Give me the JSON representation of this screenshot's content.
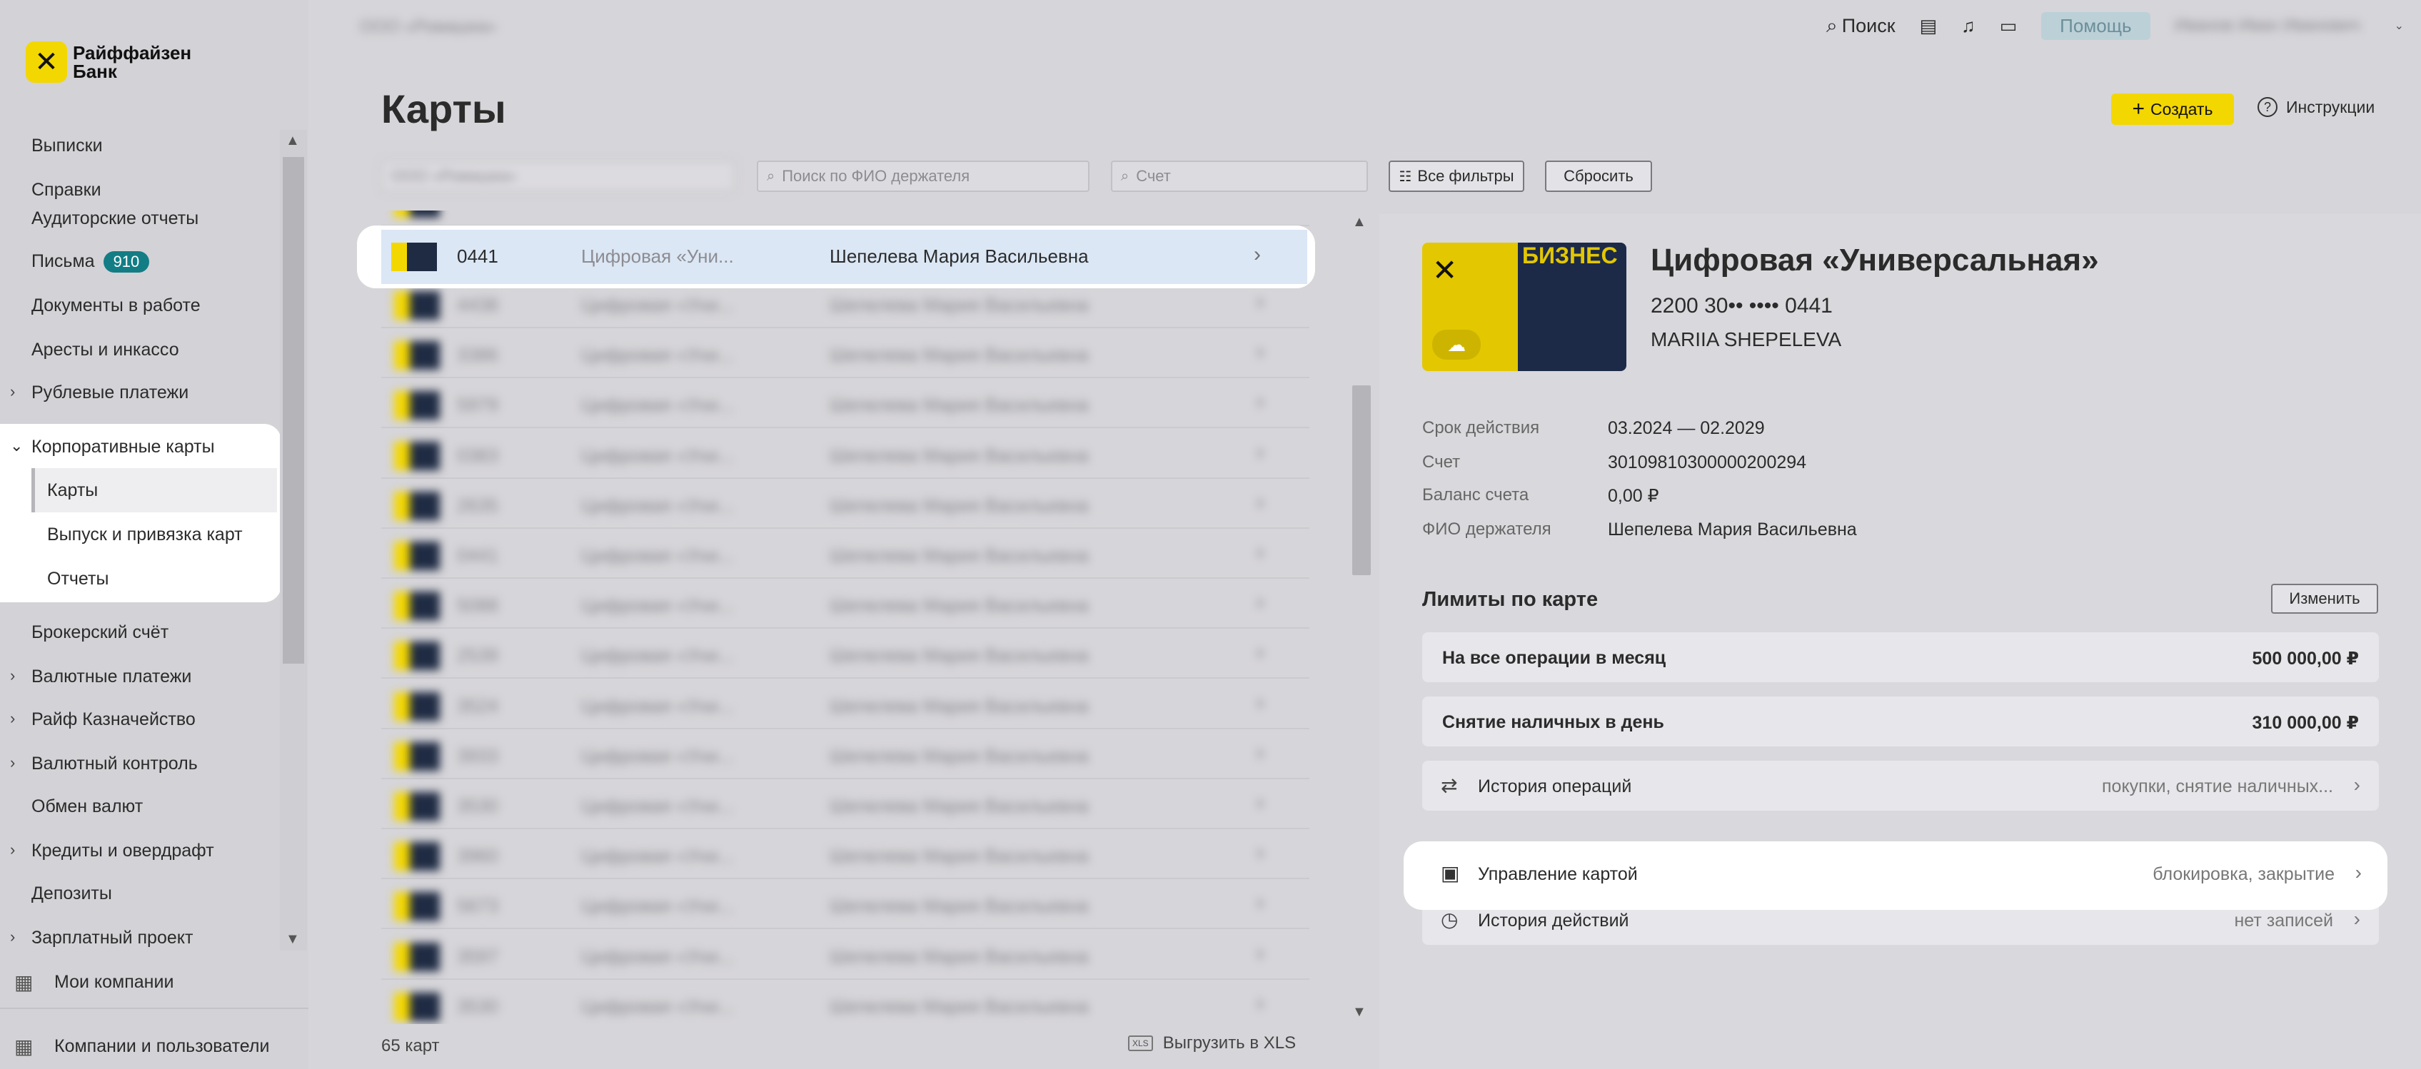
{
  "sidebar": {
    "logo_text": "Райффайзен Банк",
    "items": [
      {
        "label": "Выписки"
      },
      {
        "label": "Справки"
      },
      {
        "label": "Аудиторские отчеты"
      },
      {
        "label": "Письма",
        "badge": "910"
      },
      {
        "label": "Документы в работе"
      },
      {
        "label": "Аресты и инкассо"
      },
      {
        "label": "Рублевые платежи"
      },
      {
        "label": "Корпоративные карты"
      },
      {
        "label": "Брокерский счёт"
      },
      {
        "label": "Валютные платежи"
      },
      {
        "label": "Райф Казначейство"
      },
      {
        "label": "Валютный контроль"
      },
      {
        "label": "Обмен валют"
      },
      {
        "label": "Кредиты и овердрафт"
      },
      {
        "label": "Депозиты"
      },
      {
        "label": "Зарплатный проект"
      }
    ],
    "corp_cards_sub": [
      {
        "label": "Карты"
      },
      {
        "label": "Выпуск и привязка карт"
      },
      {
        "label": "Отчеты"
      }
    ],
    "footer": {
      "my_companies": "Мои компании",
      "companies_users": "Компании и пользователи"
    }
  },
  "header": {
    "org_name": "ООО «Ромашка»",
    "search_label": "Поиск",
    "help_label": "Помощь",
    "user_name": "Иванов Иван Иванович"
  },
  "page": {
    "title": "Карты",
    "create_label": "Создать",
    "instructions_label": "Инструкции"
  },
  "filters": {
    "account_select": "ООО «Ромашка»",
    "holder_search_placeholder": "Поиск по ФИО держателя",
    "account_placeholder": "Счет",
    "all_filters_label": "Все фильтры",
    "reset_label": "Сбросить"
  },
  "list": {
    "selected": {
      "last4": "0441",
      "product": "Цифровая «Уни...",
      "holder": "Шепелева Мария Васильевна"
    },
    "rows": [
      {
        "last4": "4438",
        "product": "Цифровая «Уни...",
        "holder": "Шепелева Мария Васильевна"
      },
      {
        "last4": "3386",
        "product": "Цифровая «Уни...",
        "holder": "Шепелева Мария Васильевна"
      },
      {
        "last4": "5979",
        "product": "Цифровая «Уни...",
        "holder": "Шепелева Мария Васильевна"
      },
      {
        "last4": "0383",
        "product": "Цифровая «Уни...",
        "holder": "Шепелева Мария Васильевна"
      },
      {
        "last4": "2635",
        "product": "Цифровая «Уни...",
        "holder": "Шепелева Мария Васильевна"
      },
      {
        "last4": "0441",
        "product": "Цифровая «Уни...",
        "holder": "Шепелева Мария Васильевна"
      },
      {
        "last4": "5088",
        "product": "Цифровая «Уни...",
        "holder": "Шепелева Мария Васильевна"
      },
      {
        "last4": "2539",
        "product": "Цифровая «Уни...",
        "holder": "Шепелева Мария Васильевна"
      },
      {
        "last4": "3524",
        "product": "Цифровая «Уни...",
        "holder": "Шепелева Мария Васильевна"
      },
      {
        "last4": "3933",
        "product": "Цифровая «Уни...",
        "holder": "Шепелева Мария Васильевна"
      },
      {
        "last4": "3530",
        "product": "Цифровая «Уни...",
        "holder": "Шепелева Мария Васильевна"
      },
      {
        "last4": "3960",
        "product": "Цифровая «Уни...",
        "holder": "Шепелева Мария Васильевна"
      },
      {
        "last4": "5673",
        "product": "Цифровая «Уни...",
        "holder": "Шепелева Мария Васильевна"
      },
      {
        "last4": "3597",
        "product": "Цифровая «Уни...",
        "holder": "Шепелева Мария Васильевна"
      },
      {
        "last4": "3530",
        "product": "Цифровая «Уни...",
        "holder": "Шепелева Мария Васильевна"
      }
    ],
    "count_label": "65 карт",
    "export_label": "Выгрузить в XLS"
  },
  "detail": {
    "card_title": "Цифровая «Универсальная»",
    "card_number": "2200 30•• •••• 0441",
    "card_holder_latin": "MARIIA SHEPELEVA",
    "card_badge": "БИЗНЕС",
    "fields": [
      {
        "label": "Срок действия",
        "value": "03.2024 — 02.2029"
      },
      {
        "label": "Счет",
        "value": "30109810300000200294"
      },
      {
        "label": "Баланс счета",
        "value": "0,00 ₽"
      },
      {
        "label": "ФИО держателя",
        "value": "Шепелева Мария Васильевна"
      }
    ],
    "limits_title": "Лимиты по карте",
    "edit_label": "Изменить",
    "limits": [
      {
        "label": "На все операции в месяц",
        "value": "500 000,00 ₽"
      },
      {
        "label": "Снятие наличных в день",
        "value": "310 000,00 ₽"
      }
    ],
    "history_ops": {
      "label": "История операций",
      "hint": "покупки, снятие наличных..."
    },
    "card_mgmt": {
      "label": "Управление картой",
      "hint": "блокировка, закрытие"
    },
    "history_actions": {
      "label": "История действий",
      "hint": "нет записей"
    }
  }
}
